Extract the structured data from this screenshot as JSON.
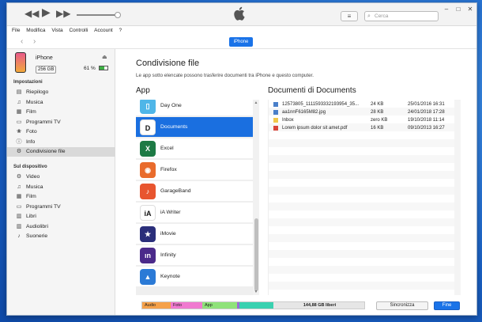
{
  "window": {
    "search_placeholder": "Cerca",
    "list_view_icon": "≡",
    "controls": [
      "–",
      "□",
      "✕"
    ]
  },
  "menubar": [
    "File",
    "Modifica",
    "Vista",
    "Controlli",
    "Account",
    "?"
  ],
  "navbar": {
    "device_button": "iPhone"
  },
  "device": {
    "name": "iPhone",
    "capacity": "256 GB",
    "battery": "61 %",
    "battery_level": 0.61
  },
  "sidebar": {
    "settings_header": "Impostazioni",
    "settings": [
      {
        "label": "Riepilogo",
        "icon": "▤"
      },
      {
        "label": "Musica",
        "icon": "♫"
      },
      {
        "label": "Film",
        "icon": "▦"
      },
      {
        "label": "Programmi TV",
        "icon": "▭"
      },
      {
        "label": "Foto",
        "icon": "❀"
      },
      {
        "label": "Info",
        "icon": "ⓘ"
      },
      {
        "label": "Condivisione file",
        "icon": "⚙"
      }
    ],
    "device_header": "Sul dispositivo",
    "device_items": [
      {
        "label": "Video",
        "icon": "⚙"
      },
      {
        "label": "Musica",
        "icon": "♫"
      },
      {
        "label": "Film",
        "icon": "▦"
      },
      {
        "label": "Programmi TV",
        "icon": "▭"
      },
      {
        "label": "Libri",
        "icon": "▥"
      },
      {
        "label": "Audiolibri",
        "icon": "▥"
      },
      {
        "label": "Suonerie",
        "icon": "♪"
      }
    ]
  },
  "main": {
    "title": "Condivisione file",
    "subtitle": "Le app sotto elencate possono trasferire documenti tra iPhone e questo computer.",
    "apps_header": "App",
    "docs_header": "Documenti di Documents",
    "apps": [
      {
        "label": "Day One",
        "color": "#4fb6e8",
        "glyph": "▯"
      },
      {
        "label": "Documents",
        "color": "#ffffff",
        "glyph": "D"
      },
      {
        "label": "Excel",
        "color": "#1d7a45",
        "glyph": "X"
      },
      {
        "label": "Firefox",
        "color": "#e96b2c",
        "glyph": "◉"
      },
      {
        "label": "GarageBand",
        "color": "#e8552f",
        "glyph": "♪"
      },
      {
        "label": "iA Writer",
        "color": "#ffffff",
        "glyph": "iA"
      },
      {
        "label": "iMovie",
        "color": "#2a2e7a",
        "glyph": "★"
      },
      {
        "label": "Infinity",
        "color": "#4b2a8a",
        "glyph": "ın"
      },
      {
        "label": "Keynote",
        "color": "#2b7ad6",
        "glyph": "▲"
      }
    ],
    "documents": [
      {
        "name": "12573805_1111593332193954_35...",
        "size": "24 KB",
        "date": "25/01/2016 16:31",
        "icon": "image"
      },
      {
        "name": "aa1nnF6165M82.jpg",
        "size": "28 KB",
        "date": "24/01/2018 17:28",
        "icon": "image"
      },
      {
        "name": "Inbox",
        "size": "zero KB",
        "date": "19/10/2018 11:14",
        "icon": "folder"
      },
      {
        "name": "Lorem ipsum dolor sit amet.pdf",
        "size": "16 KB",
        "date": "09/10/2013 16:27",
        "icon": "pdf"
      }
    ],
    "storage": {
      "segments": [
        {
          "label": "Audio",
          "color": "#f5a14a"
        },
        {
          "label": "Foto",
          "color": "#f07ad0"
        },
        {
          "label": "App",
          "color": "#8fe27a"
        },
        {
          "label": "",
          "color": "#9a6ad6"
        },
        {
          "label": "",
          "color": "#39d1b0"
        }
      ],
      "free": "144,88 GB liberi"
    },
    "sync_button": "Sincronizza",
    "done_button": "Fine"
  }
}
